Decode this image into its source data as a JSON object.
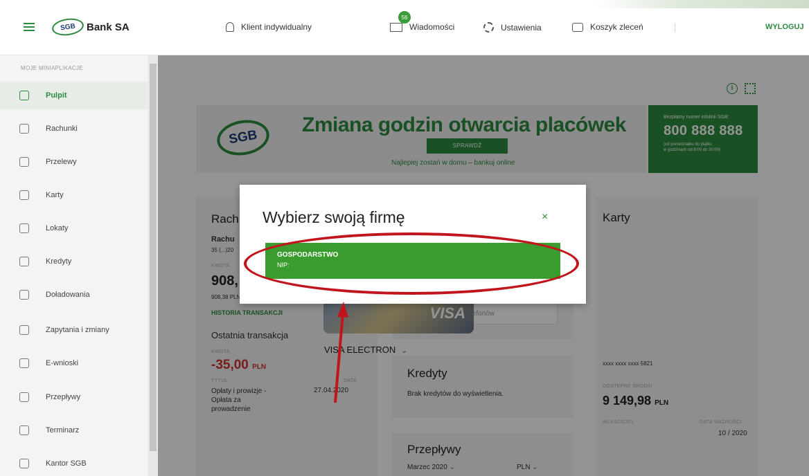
{
  "topbar": {
    "brand": "Bank SA",
    "brand_logo_text": "SGB",
    "client_label": "Klient indywidualny",
    "messages_label": "Wiadomości",
    "messages_badge": "56",
    "settings_label": "Ustawienia",
    "cart_label": "Koszyk zleceń",
    "logout_label": "WYLOGUJ"
  },
  "sidebar": {
    "heading": "MOJE MINIAPLIKACJE",
    "items": [
      {
        "label": "Pulpit",
        "icon": "dashboard-icon"
      },
      {
        "label": "Rachunki",
        "icon": "accounts-icon"
      },
      {
        "label": "Przelewy",
        "icon": "transfer-icon"
      },
      {
        "label": "Karty",
        "icon": "card-icon"
      },
      {
        "label": "Lokaty",
        "icon": "deposit-icon"
      },
      {
        "label": "Kredyty",
        "icon": "loan-icon"
      },
      {
        "label": "Doładowania",
        "icon": "topup-icon"
      },
      {
        "label": "Zapytania i zmiany",
        "icon": "request-icon"
      },
      {
        "label": "E-wnioski",
        "icon": "eapplication-icon"
      },
      {
        "label": "Przepływy",
        "icon": "flows-icon"
      },
      {
        "label": "Terminarz",
        "icon": "calendar-icon"
      },
      {
        "label": "Kantor SGB",
        "icon": "exchange-icon"
      }
    ]
  },
  "banner": {
    "logo_text": "SGB",
    "title": "Zmiana godzin otwarcia placówek",
    "button": "SPRAWDŹ",
    "subtitle": "Najlepiej zostań w domu – bankuj online",
    "hotline_label": "Bezpłatny numer infolinii SGB:",
    "hotline_number": "800 888 888",
    "hotline_note_1": "(od poniedziałku do piątku",
    "hotline_note_2": "w godzinach od 8:00 do 20:00)"
  },
  "accounts": {
    "title": "Rach",
    "account_name": "Rachu",
    "account_number": "35 (...)20",
    "amount_label": "KWOTA",
    "amount": "908,",
    "amount_sub": "908,38 PLN",
    "history_link": "HISTORIA TRANSAKCJI",
    "last_tx": "Ostatnia transakcja",
    "tx_amount_label": "KWOTA",
    "tx_amount": "-35,00",
    "tx_currency": "PLN",
    "title_label": "TYTUŁ",
    "date_label": "DATA",
    "tx_title_1": "Opłaty i prowizje -",
    "tx_title_2": "Opłata za",
    "tx_title_3": "prowadzenie",
    "tx_date": "27.04.2020"
  },
  "phones": {
    "empty": "Brak numerów telefonów"
  },
  "loans": {
    "title": "Kredyty",
    "empty": "Brak kredytów do wyświetlenia."
  },
  "flows": {
    "title": "Przepływy",
    "month": "Marzec 2020",
    "currency": "PLN"
  },
  "cards": {
    "title": "Karty",
    "card_name": "VISA ELECTRON",
    "card_number": "xxxx xxxx xxxx 5821",
    "available_label": "DOSTĘPNE ŚRODKI",
    "available": "9 149,98",
    "available_currency": "PLN",
    "owner_label": "WŁAŚCICIEL",
    "expiry_label": "DATA WAŻNOŚCI",
    "expiry": "10 / 2020",
    "visa_logo": "VISA"
  },
  "dialog": {
    "title": "Wybierz swoją firmę",
    "close": "×",
    "company_name": "GOSPODARSTWO",
    "company_nip": "NIP:"
  },
  "colors": {
    "brand_green": "#2b8a3e",
    "annotation_red": "#c0151c",
    "negative_red": "#d0312d"
  }
}
